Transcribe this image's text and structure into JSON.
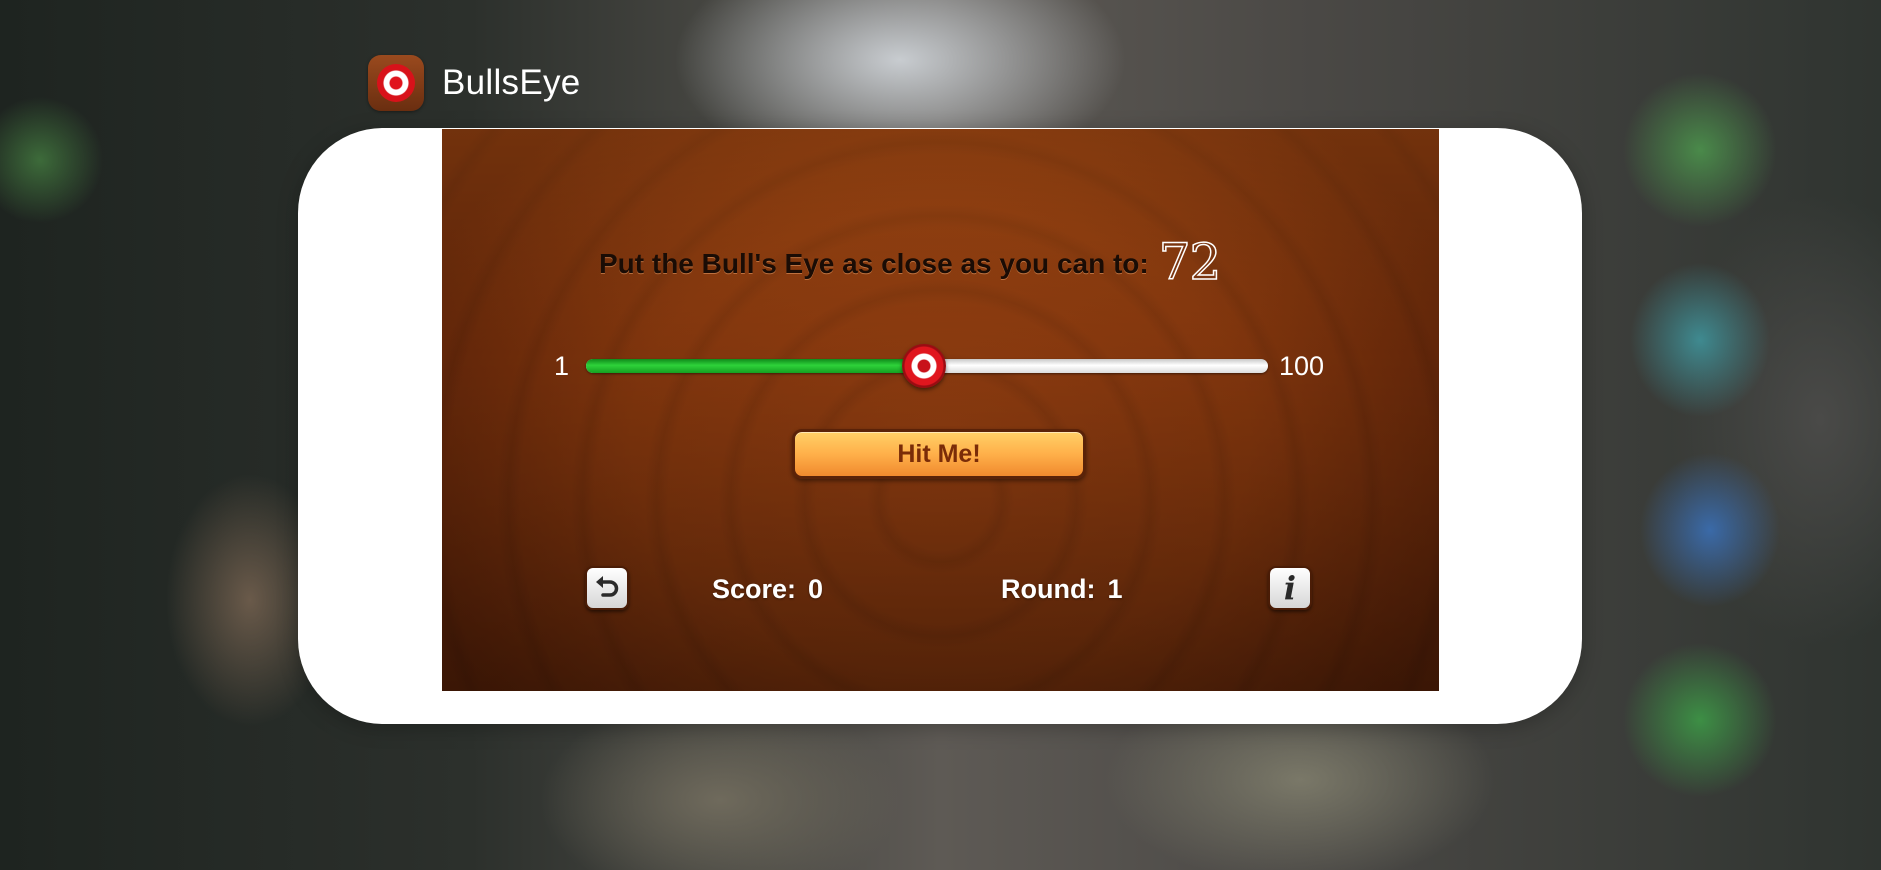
{
  "switcher": {
    "app_name": "BullsEye",
    "app_icon": "bullseye-app-icon"
  },
  "game": {
    "prompt": "Put the Bull's Eye as close as you can to:",
    "target": "72",
    "slider": {
      "min_label": "1",
      "max_label": "100",
      "value": 50,
      "min": 1,
      "max": 100
    },
    "hit_button_label": "Hit Me!",
    "score_label": "Score:",
    "score_value": "0",
    "round_label": "Round:",
    "round_value": "1",
    "restart_icon": "restart-icon",
    "info_icon": "info-icon"
  },
  "colors": {
    "wood": "#8e3c10",
    "slider_fill": "#2ed23a",
    "button": "#ffb04a",
    "button_text": "#7a2c08",
    "thumb_red": "#e0161e"
  }
}
